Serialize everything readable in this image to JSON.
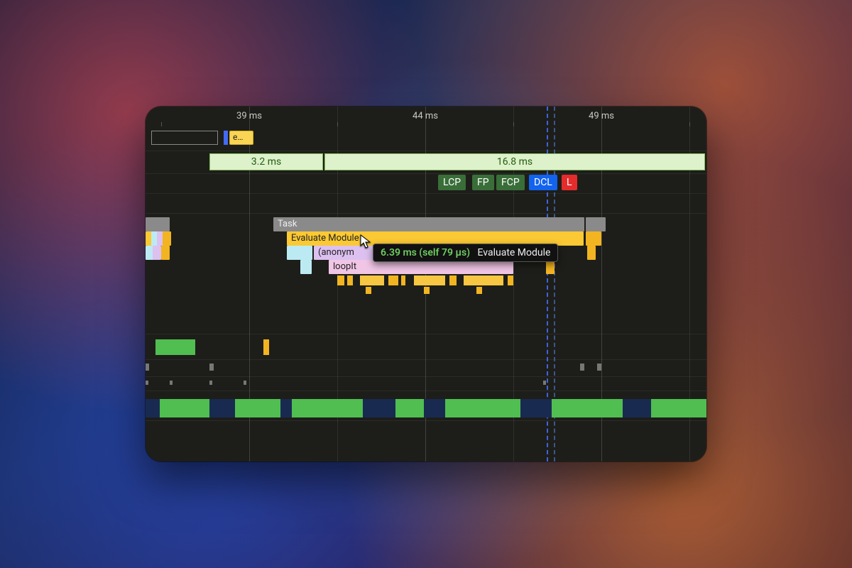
{
  "ruler": {
    "ticks": [
      "39 ms",
      "44 ms",
      "49 ms"
    ]
  },
  "overview": {
    "chip_label": "e…"
  },
  "frames": {
    "first": "3.2 ms",
    "second": "16.8 ms"
  },
  "timings": {
    "lcp": "LCP",
    "fp": "FP",
    "fcp": "FCP",
    "dcl": "DCL",
    "l": "L"
  },
  "flame": {
    "task": "Task",
    "evaluate_module": "Evaluate Module",
    "anonymous": "(anonym",
    "loopit": "loopIt"
  },
  "tooltip": {
    "duration": "6.39 ms (self 79 µs)",
    "name": "Evaluate Module"
  }
}
